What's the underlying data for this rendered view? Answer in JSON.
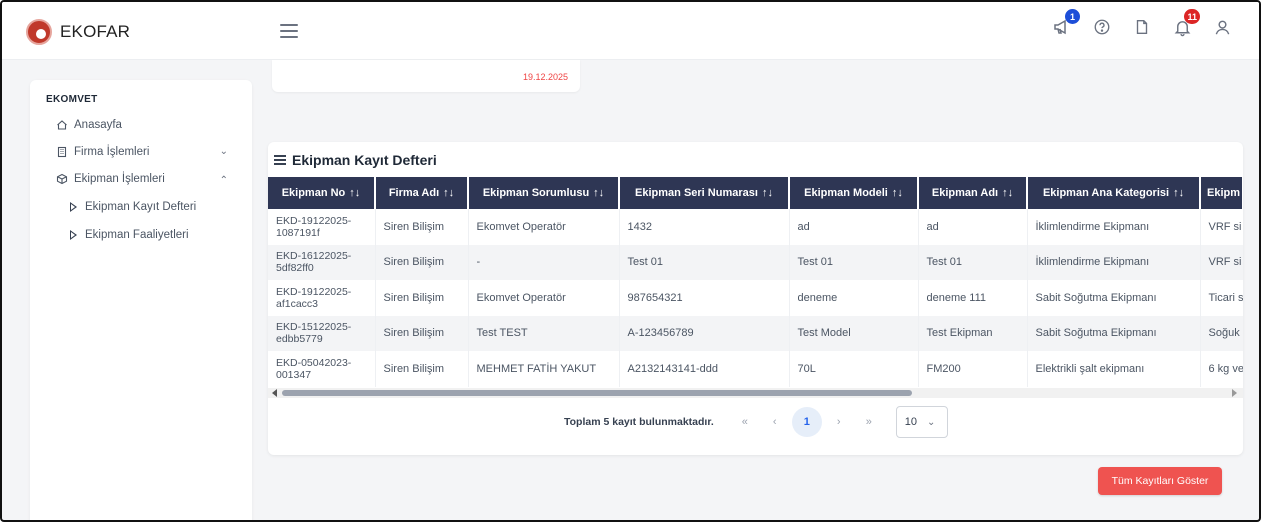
{
  "app": {
    "name": "EKOFAR"
  },
  "header": {
    "icons": [
      {
        "name": "announcement-icon",
        "badge": "1",
        "badge_color": "#1d4ed8"
      },
      {
        "name": "help-icon",
        "badge": ""
      },
      {
        "name": "document-icon",
        "badge": ""
      },
      {
        "name": "bell-icon",
        "badge": "11",
        "badge_color": "#dc2626"
      },
      {
        "name": "user-icon",
        "badge": ""
      }
    ]
  },
  "sidebar": {
    "section": "EKOMVET",
    "items": [
      {
        "label": "Anasayfa",
        "icon": "home-icon"
      },
      {
        "label": "Firma İşlemleri",
        "icon": "building-icon",
        "chevron": "⌄"
      },
      {
        "label": "Ekipman İşlemleri",
        "icon": "box-icon",
        "chevron": "⌃"
      }
    ],
    "subitems": [
      {
        "label": "Ekipman Kayıt Defteri"
      },
      {
        "label": "Ekipman Faaliyetleri"
      }
    ]
  },
  "top_card": {
    "date": "19.12.2025"
  },
  "registry": {
    "title": "Ekipman Kayıt Defteri",
    "sort_glyph": "↑↓",
    "columns": [
      "Ekipman No",
      "Firma Adı",
      "Ekipman Sorumlusu",
      "Ekipman Seri Numarası",
      "Ekipman Modeli",
      "Ekipman Adı",
      "Ekipman Ana Kategorisi",
      "Ekipm"
    ],
    "rows": [
      [
        "EKD-19122025-1087191f",
        "Siren Bilişim",
        "Ekomvet Operatör",
        "1432",
        "ad",
        "ad",
        "İklimlendirme Ekipmanı",
        "VRF si"
      ],
      [
        "EKD-16122025-5df82ff0",
        "Siren Bilişim",
        "-",
        "Test 01",
        "Test 01",
        "Test 01",
        "İklimlendirme Ekipmanı",
        "VRF si"
      ],
      [
        "EKD-19122025-af1cacc3",
        "Siren Bilişim",
        "Ekomvet Operatör",
        "987654321",
        "deneme",
        "deneme 111",
        "Sabit Soğutma Ekipmanı",
        "Ticari s"
      ],
      [
        "EKD-15122025-edbb5779",
        "Siren Bilişim",
        "Test TEST",
        "A-123456789",
        "Test Model",
        "Test Ekipman",
        "Sabit Soğutma Ekipmanı",
        "Soğuk"
      ],
      [
        "EKD-05042023-001347",
        "Siren Bilişim",
        "MEHMET FATİH YAKUT",
        "A2132143141-ddd",
        "70L",
        "FM200",
        "Elektrikli şalt ekipmanı",
        "6 kg ve"
      ]
    ],
    "pagination": {
      "total_text": "Toplam 5 kayıt bulunmaktadır.",
      "first": "«",
      "prev": "‹",
      "current_page": "1",
      "next": "›",
      "last": "»",
      "page_size": "10"
    }
  },
  "show_all_button": "Tüm Kayıtları Göster",
  "colors": {
    "table_header": "#2e3654",
    "accent_button": "#ef5350",
    "date_text": "#ef4444"
  }
}
